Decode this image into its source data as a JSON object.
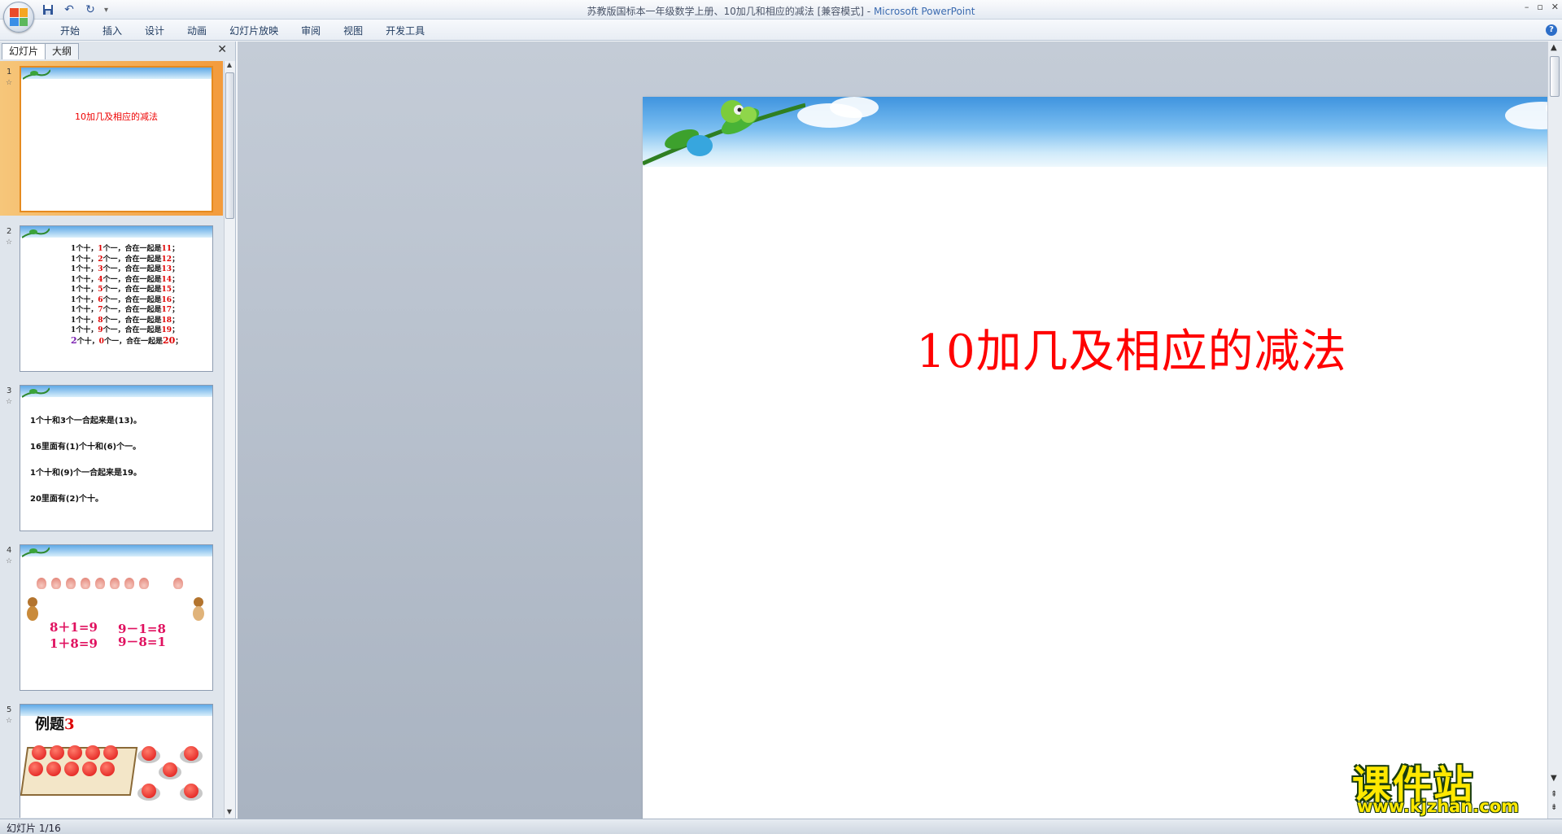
{
  "window": {
    "title": "苏教版国标本一年级数学上册、10加几和相应的减法 [兼容模式] - ",
    "app_name": "Microsoft PowerPoint",
    "controls": [
      "–",
      "▫",
      "✕"
    ]
  },
  "quick_access": {
    "icons": [
      "save-icon",
      "undo-icon",
      "redo-icon"
    ],
    "customize": "▾"
  },
  "ribbon": {
    "tabs": [
      "开始",
      "插入",
      "设计",
      "动画",
      "幻灯片放映",
      "审阅",
      "视图",
      "开发工具"
    ],
    "help": "?"
  },
  "left_pane": {
    "tabs": [
      "幻灯片",
      "大纲"
    ],
    "active_tab": "幻灯片",
    "close": "✕"
  },
  "thumbnails": [
    {
      "number": "1",
      "star": "☆",
      "title": "10加几及相应的减法",
      "selected": true
    },
    {
      "number": "2",
      "star": "☆",
      "lines": [
        [
          "1个十，",
          "1",
          "个一，合在一起是",
          "11",
          "；"
        ],
        [
          "1个十，",
          "2",
          "个一，合在一起是",
          "12",
          "；"
        ],
        [
          "1个十，",
          "3",
          "个一，合在一起是",
          "13",
          "；"
        ],
        [
          "1个十，",
          "4",
          "个一，合在一起是",
          "14",
          "；"
        ],
        [
          "1个十，",
          "5",
          "个一，合在一起是",
          "15",
          "；"
        ],
        [
          "1个十，",
          "6",
          "个一，合在一起是",
          "16",
          "；"
        ],
        [
          "1个十，",
          "7",
          "个一，合在一起是",
          "17",
          "；"
        ],
        [
          "1个十，",
          "8",
          "个一，合在一起是",
          "18",
          "；"
        ],
        [
          "1个十，",
          "9",
          "个一，合在一起是",
          "19",
          "；"
        ]
      ],
      "last_line": [
        "2",
        "个十，",
        "0",
        "个一，合在一起是",
        "20",
        "；"
      ]
    },
    {
      "number": "3",
      "star": "☆",
      "lines": [
        "1个十和3个一合起来是(13)。",
        "16里面有(1)个十和(6)个一。",
        "1个十和(9)个一合起来是19。",
        "20里面有(2)个十。"
      ]
    },
    {
      "number": "4",
      "star": "☆",
      "equations": [
        "8＋1=9",
        "1＋8=9",
        "9－1=8",
        "9－8=1"
      ]
    },
    {
      "number": "5",
      "star": "☆",
      "title_text": "例题",
      "title_number": "3"
    }
  ],
  "slide": {
    "title": "10加几及相应的减法"
  },
  "watermark": {
    "main": "课件站",
    "url": "www.kjzhan.com"
  },
  "status": {
    "text": "幻灯片 1/16"
  },
  "colors": {
    "title_red": "#ff0000",
    "selection_orange": "#f39b3c",
    "watermark_yellow": "#ffe800"
  }
}
